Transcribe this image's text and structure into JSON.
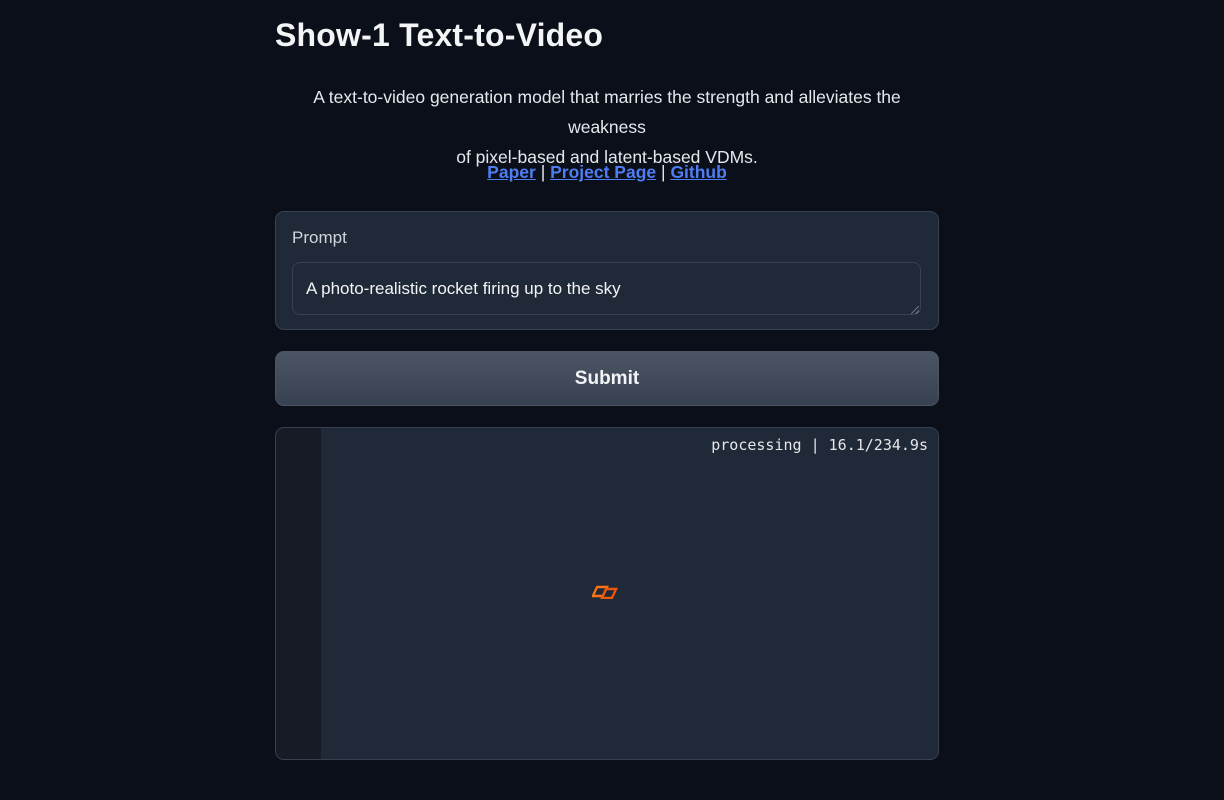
{
  "header": {
    "title": "Show-1 Text-to-Video",
    "description_line1": "A text-to-video generation model that marries the strength and alleviates the weakness",
    "description_line2": "of pixel-based and latent-based VDMs."
  },
  "links": {
    "paper": "Paper",
    "project_page": "Project Page",
    "github": "Github",
    "separator": "|"
  },
  "prompt": {
    "label": "Prompt",
    "value": "A photo-realistic rocket firing up to the sky"
  },
  "submit": {
    "label": "Submit"
  },
  "output": {
    "status": "processing | 16.1/234.9s",
    "loader_icon": "loading-spinner-icon"
  },
  "colors": {
    "background": "#0b0f19",
    "panel": "#1f2937",
    "link": "#4f7df3",
    "loader": "#f97316"
  }
}
